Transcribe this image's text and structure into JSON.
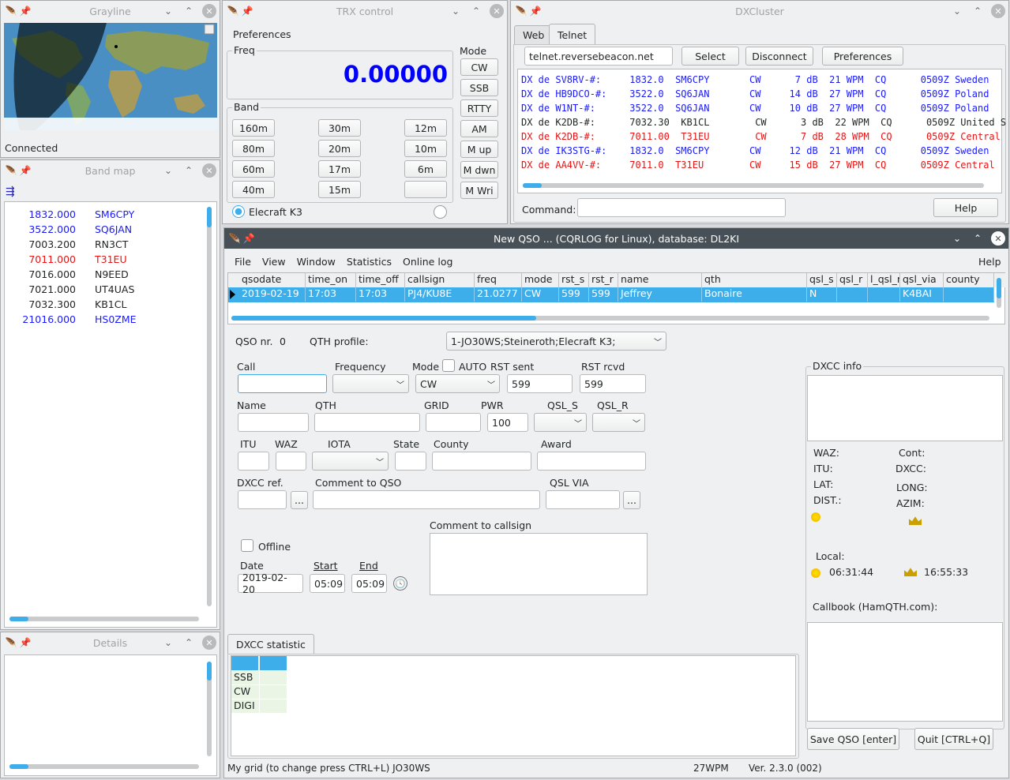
{
  "grayline": {
    "title": "Grayline",
    "status": "Connected"
  },
  "bandmap": {
    "title": "Band map",
    "spots": [
      {
        "freq": "1832.000",
        "call": "SM6CPY",
        "color": "#1a1aff"
      },
      {
        "freq": "3522.000",
        "call": "SQ6JAN",
        "color": "#1a1aff"
      },
      {
        "freq": "7003.200",
        "call": "RN3CT",
        "color": "#232627"
      },
      {
        "freq": "7011.000",
        "call": "T31EU",
        "color": "#e81414"
      },
      {
        "freq": "7016.000",
        "call": "N9EED",
        "color": "#232627"
      },
      {
        "freq": "7021.000",
        "call": "UT4UAS",
        "color": "#232627"
      },
      {
        "freq": "7032.300",
        "call": "KB1CL",
        "color": "#232627"
      },
      {
        "freq": "21016.000",
        "call": "HS0ZME",
        "color": "#1a1aff"
      }
    ]
  },
  "details": {
    "title": "Details"
  },
  "trx": {
    "title": "TRX control",
    "menu": "Preferences",
    "freq_label": "Freq",
    "freq": "0.00000",
    "band_label": "Band",
    "bands": [
      "160m",
      "30m",
      "12m",
      "80m",
      "20m",
      "10m",
      "60m",
      "17m",
      "6m",
      "40m",
      "15m",
      ""
    ],
    "mode_label": "Mode",
    "modes": [
      "CW",
      "SSB",
      "RTTY",
      "AM",
      "M up",
      "M dwn",
      "M Wri"
    ],
    "radio": "Elecraft K3"
  },
  "dxc": {
    "title": "DXCluster",
    "tabs": [
      "Web",
      "Telnet"
    ],
    "server": "telnet.reversebeacon.net",
    "select": "Select",
    "disconnect": "Disconnect",
    "preferences": "Preferences",
    "spots": [
      {
        "text": "DX de SV8RV-#:     1832.0  SM6CPY       CW      7 dB  21 WPM  CQ      0509Z Sweden",
        "color": "#1a1aff"
      },
      {
        "text": "DX de HB9DCO-#:    3522.0  SQ6JAN       CW     14 dB  27 WPM  CQ      0509Z Poland",
        "color": "#1a1aff"
      },
      {
        "text": "DX de W1NT-#:      3522.0  SQ6JAN       CW     10 dB  27 WPM  CQ      0509Z Poland",
        "color": "#1a1aff"
      },
      {
        "text": "DX de K2DB-#:      7032.30  KB1CL        CW      3 dB  22 WPM  CQ      0509Z United S",
        "color": "#232627"
      },
      {
        "text": "DX de K2DB-#:      7011.00  T31EU        CW      7 dB  28 WPM  CQ      0509Z Central",
        "color": "#e81414"
      },
      {
        "text": "DX de IK3STG-#:    1832.0  SM6CPY       CW     12 dB  21 WPM  CQ      0509Z Sweden",
        "color": "#1a1aff"
      },
      {
        "text": "DX de AA4VV-#:     7011.0  T31EU        CW     15 dB  27 WPM  CQ      0509Z Central",
        "color": "#e81414"
      }
    ],
    "command_label": "Command:",
    "help": "Help"
  },
  "qso": {
    "title": "New QSO ... (CQRLOG for Linux), database: DL2KI",
    "menu": [
      "File",
      "View",
      "Window",
      "Statistics",
      "Online log"
    ],
    "help": "Help",
    "columns": [
      "qsodate",
      "time_on",
      "time_off",
      "callsign",
      "freq",
      "mode",
      "rst_s",
      "rst_r",
      "name",
      "qth",
      "qsl_s",
      "qsl_r",
      "l_qsl_r",
      "qsl_via",
      "county"
    ],
    "row": [
      "2019-02-19",
      "17:03",
      "17:03",
      "PJ4/KU8E",
      "21.0277",
      "CW",
      "599",
      "599",
      "Jeffrey",
      "Bonaire",
      "N",
      "",
      "",
      "K4BAI",
      ""
    ],
    "qso_nr_label": "QSO nr.",
    "qso_nr": "0",
    "qth_profile_label": "QTH profile:",
    "qth_profile": "1-JO30WS;Steineroth;Elecraft K3;",
    "call_label": "Call",
    "frequency_label": "Frequency",
    "mode_label": "Mode",
    "auto_label": "AUTO",
    "rst_sent_label": "RST sent",
    "rst_rcvd_label": "RST rcvd",
    "mode": "CW",
    "rst_sent": "599",
    "rst_rcvd": "599",
    "name_label": "Name",
    "qth_label": "QTH",
    "grid_label": "GRID",
    "pwr_label": "PWR",
    "pwr": "100",
    "qsl_s_label": "QSL_S",
    "qsl_r_label": "QSL_R",
    "itu_label": "ITU",
    "waz_label": "WAZ",
    "iota_label": "IOTA",
    "state_label": "State",
    "county_label": "County",
    "award_label": "Award",
    "dxcc_ref_label": "DXCC ref.",
    "comment_qso_label": "Comment to QSO",
    "qsl_via_label": "QSL VIA",
    "dots": "...",
    "offline_label": "Offline",
    "comment_call_label": "Comment to callsign",
    "date_label": "Date",
    "start_label": "Start",
    "end_label": "End",
    "date": "2019-02-20",
    "start": "05:09",
    "end": "05:09",
    "dxcc_info_label": "DXCC info",
    "waz": "WAZ:",
    "cont": "Cont:",
    "itu": "ITU:",
    "dxcc": "DXCC:",
    "lat": "LAT:",
    "long": "LONG:",
    "dist": "DIST.:",
    "azim": "AZIM:",
    "local_label": "Local:",
    "sunrise": "06:31:44",
    "sunset": "16:55:33",
    "callbook_label": "Callbook (HamQTH.com):",
    "stat_tab": "DXCC statistic",
    "stat_rows": [
      "SSB",
      "CW",
      "DIGI"
    ],
    "save": "Save QSO [enter]",
    "quit": "Quit [CTRL+Q]",
    "status_grid": "My grid (to change press CTRL+L) JO30WS",
    "status_wpm": "27WPM",
    "status_ver": "Ver. 2.3.0 (002)"
  }
}
